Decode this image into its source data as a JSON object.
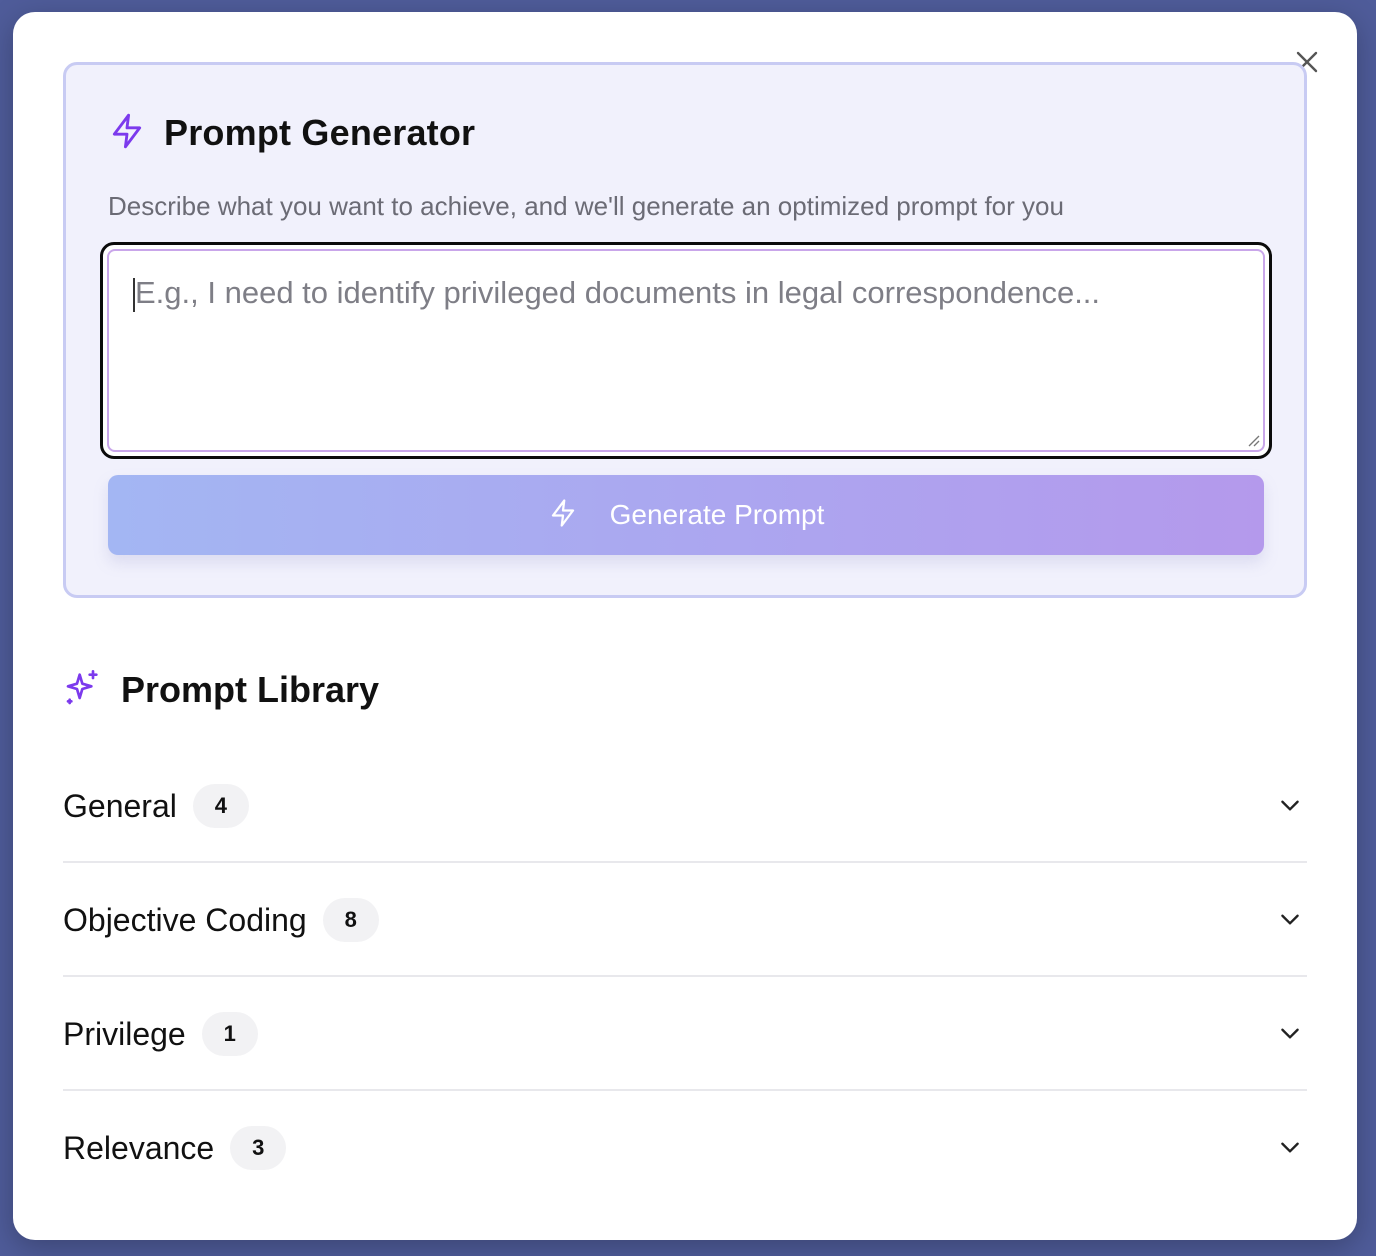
{
  "generator": {
    "title": "Prompt Generator",
    "description": "Describe what you want to achieve, and we'll generate an optimized prompt for you",
    "input": {
      "value": "",
      "placeholder": "E.g., I need to identify privileged documents in legal correspondence..."
    },
    "button_label": "Generate Prompt",
    "icon": "lightning-icon"
  },
  "library": {
    "title": "Prompt Library",
    "icon": "sparkles-icon",
    "categories": [
      {
        "label": "General",
        "count": "4"
      },
      {
        "label": "Objective Coding",
        "count": "8"
      },
      {
        "label": "Privilege",
        "count": "1"
      },
      {
        "label": "Relevance",
        "count": "3"
      }
    ]
  },
  "colors": {
    "accent": "#7c3aed",
    "backdrop": "#4f5c9a",
    "card_bg": "#f1f1fc",
    "button_gradient_start": "#a3b6f3",
    "button_gradient_end": "#b499ec"
  }
}
